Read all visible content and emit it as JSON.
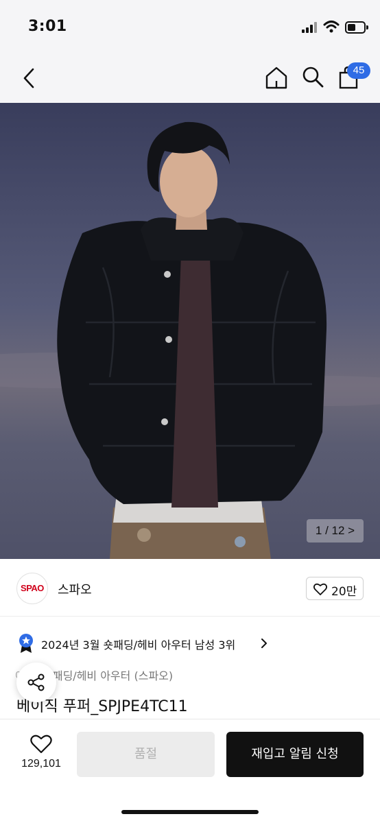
{
  "status_bar": {
    "time": "3:01"
  },
  "nav": {
    "cart_count": "45"
  },
  "hero": {
    "image_counter": "1 / 12 >"
  },
  "brand": {
    "logo_text": "SPAO",
    "name": "스파오",
    "likes": "20만"
  },
  "ranking": {
    "text": "2024년 3월 숏패딩/헤비 아우터 남성 3위"
  },
  "breadcrumb": {
    "head": "아",
    "category": "숏패딩/헤비 아우터",
    "brand": "(스파오)"
  },
  "product": {
    "title": "베이직 푸퍼_SPJPE4TC11"
  },
  "bottom": {
    "wish_count": "129,101",
    "soldout_label": "품절",
    "restock_label": "재입고 알림 신청"
  },
  "colors": {
    "accent_blue": "#2f6ce5",
    "brand_red": "#d0021b",
    "cta_black": "#111111",
    "disabled_gray": "#ececec"
  }
}
